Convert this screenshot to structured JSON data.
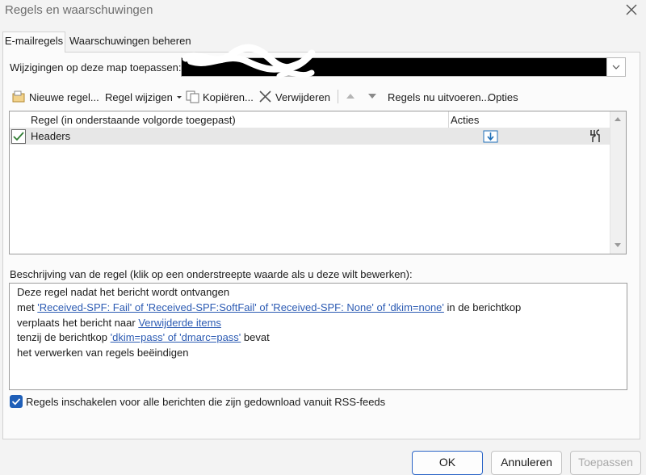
{
  "window": {
    "title": "Regels en waarschuwingen",
    "close_icon": "close-icon"
  },
  "tabs": [
    {
      "label": "E-mailregels",
      "active": true
    },
    {
      "label": "Waarschuwingen beheren",
      "active": false
    }
  ],
  "folder": {
    "label": "Wijzigingen op deze map toepassen:",
    "value": ""
  },
  "toolbar": {
    "new_rule": "Nieuwe regel...",
    "change_rule": "Regel wijzigen",
    "copy": "Kopiëren...",
    "delete": "Verwijderen",
    "run_rules": "Regels nu uitvoeren...",
    "options": "Opties"
  },
  "rules_table": {
    "columns": [
      "Regel (in onderstaande volgorde toegepast)",
      "Acties"
    ],
    "rows": [
      {
        "name": "Headers",
        "enabled": true,
        "action_icons": [
          "move-to-folder-icon",
          "wrench-icon"
        ]
      }
    ]
  },
  "description": {
    "label": "Beschrijving van de regel (klik op een onderstreepte waarde als u deze wilt bewerken):",
    "line1": "Deze regel nadat het bericht wordt ontvangen",
    "line2_pre": "met ",
    "line2_link": "'Received-SPF: Fail' of 'Received-SPF:SoftFail' of 'Received-SPF: None' of 'dkim=none'",
    "line2_post": " in de berichtkop",
    "line3_pre": "verplaats het bericht naar ",
    "line3_link": "Verwijderde items",
    "line4_pre": "tenzij de berichtkop ",
    "line4_link": "'dkim=pass' of 'dmarc=pass'",
    "line4_post": " bevat",
    "line5": "het verwerken van regels beëindigen"
  },
  "rss": {
    "label": "Regels inschakelen voor alle berichten die zijn gedownload vanuit RSS-feeds",
    "checked": true
  },
  "buttons": {
    "ok": "OK",
    "cancel": "Annuleren",
    "apply": "Toepassen"
  },
  "colors": {
    "accent": "#1f5fb8",
    "link": "#2c5bb3",
    "disabled_text": "#a8a8a8"
  }
}
